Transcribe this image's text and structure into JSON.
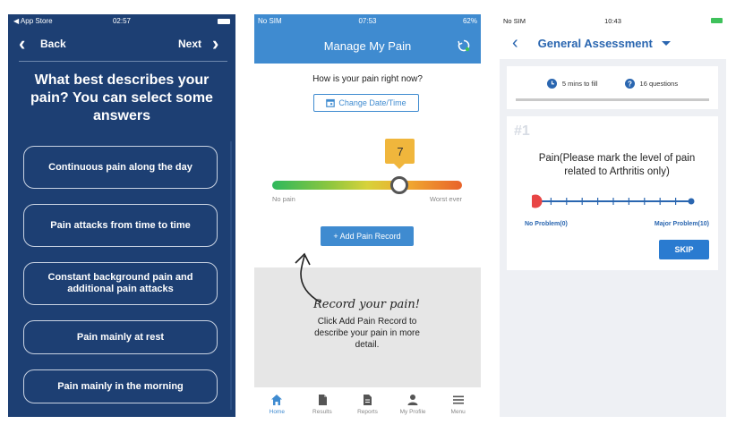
{
  "screen1": {
    "status": {
      "carrier": "◀ App Store",
      "time": "02:57"
    },
    "nav": {
      "back_label": "Back",
      "next_label": "Next"
    },
    "question": "What best describes your pain? You can select some answers",
    "options": [
      "Continuous pain along the day",
      "Pain attacks from time to time",
      "Constant background pain and additional pain attacks",
      "Pain mainly at rest",
      "Pain mainly in the morning"
    ],
    "colors": {
      "background": "#1d3f73",
      "option_border": "#c8d2e2"
    }
  },
  "screen2": {
    "status": {
      "carrier": "No SIM",
      "time": "07:53",
      "battery": "62%"
    },
    "title": "Manage My Pain",
    "prompt": "How is your pain right now?",
    "change_date_label": "Change Date/Time",
    "pain_level": 7,
    "pain_scale_max": 10,
    "scale_left_label": "No pain",
    "scale_right_label": "Worst ever",
    "add_button_label": "+ Add Pain Record",
    "record_heading": "Record your pain!",
    "record_description": "Click Add Pain Record to describe your pain in more detail.",
    "tabs": [
      {
        "label": "Home",
        "icon": "home-icon",
        "active": true
      },
      {
        "label": "Results",
        "icon": "document-icon",
        "active": false
      },
      {
        "label": "Reports",
        "icon": "report-icon",
        "active": false
      },
      {
        "label": "My Profile",
        "icon": "user-icon",
        "active": false
      },
      {
        "label": "Menu",
        "icon": "menu-icon",
        "active": false
      }
    ],
    "colors": {
      "header": "#3f8bd0",
      "badge": "#f0b63c"
    }
  },
  "screen3": {
    "status": {
      "carrier": "No SIM",
      "time": "10:43"
    },
    "title": "General Assessment",
    "time_to_fill": "5 mins to fill",
    "questions_count": "16 questions",
    "question_number": "#1",
    "question_text": "Pain(Please mark the level of pain related to Arthritis only)",
    "slider_value": 0,
    "slider_max": 10,
    "min_label": "No Problem(0)",
    "max_label": "Major Problem(10)",
    "skip_label": "SKIP",
    "colors": {
      "accent": "#2a66b0",
      "slider_thumb": "#e84545"
    }
  }
}
